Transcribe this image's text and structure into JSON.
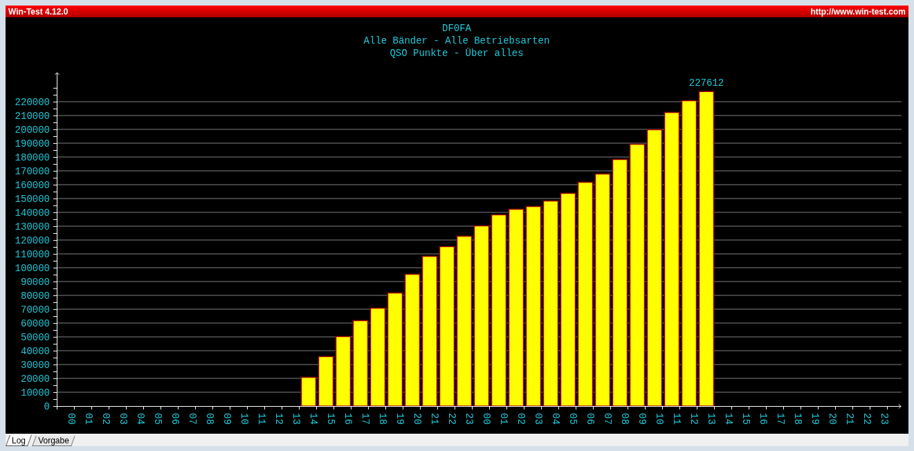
{
  "window": {
    "title": "Win-Test 4.12.0",
    "url": "http://www.win-test.com"
  },
  "chart": {
    "chart_data": {
      "type": "bar",
      "title": "DF0FA\nAlle Bänder - Alle Betriebsarten\nQSO Punkte - Über alles",
      "categories": [
        "00",
        "01",
        "02",
        "03",
        "04",
        "05",
        "06",
        "07",
        "08",
        "09",
        "10",
        "11",
        "12",
        "13",
        "14",
        "15",
        "16",
        "17",
        "18",
        "19",
        "20",
        "21",
        "22",
        "23",
        "00",
        "01",
        "02",
        "03",
        "04",
        "05",
        "06",
        "07",
        "08",
        "09",
        "10",
        "11",
        "12",
        "13",
        "14",
        "15",
        "16",
        "17",
        "18",
        "19",
        "20",
        "21",
        "22",
        "23"
      ],
      "series": [
        {
          "color": "#ffff00",
          "values": [
            null,
            null,
            null,
            null,
            null,
            null,
            null,
            null,
            null,
            null,
            null,
            null,
            null,
            null,
            21000,
            36000,
            50500,
            62000,
            71000,
            82000,
            95500,
            108500,
            115500,
            123000,
            130500,
            138500,
            142500,
            144500,
            148500,
            154000,
            162000,
            168000,
            178500,
            189500,
            200000,
            212500,
            221000,
            227612,
            null,
            null,
            null,
            null,
            null,
            null,
            null,
            null,
            null,
            null
          ]
        }
      ],
      "ylim": [
        0,
        241000
      ],
      "grid": true,
      "yticks": [
        0,
        10000,
        20000,
        30000,
        40000,
        50000,
        60000,
        70000,
        80000,
        90000,
        100000,
        110000,
        120000,
        130000,
        140000,
        150000,
        160000,
        170000,
        180000,
        190000,
        200000,
        210000,
        220000
      ],
      "value_labels": [
        null,
        null,
        null,
        null,
        null,
        null,
        null,
        null,
        null,
        null,
        null,
        null,
        null,
        null,
        null,
        null,
        null,
        null,
        null,
        null,
        null,
        null,
        null,
        null,
        null,
        null,
        null,
        null,
        null,
        null,
        null,
        null,
        null,
        null,
        null,
        null,
        null,
        "227612",
        null,
        null,
        null,
        null,
        null,
        null,
        null,
        null,
        null,
        null
      ]
    }
  },
  "tabs": [
    {
      "label": "Log",
      "selected": true
    },
    {
      "label": "Vorgabe",
      "selected": false
    }
  ]
}
